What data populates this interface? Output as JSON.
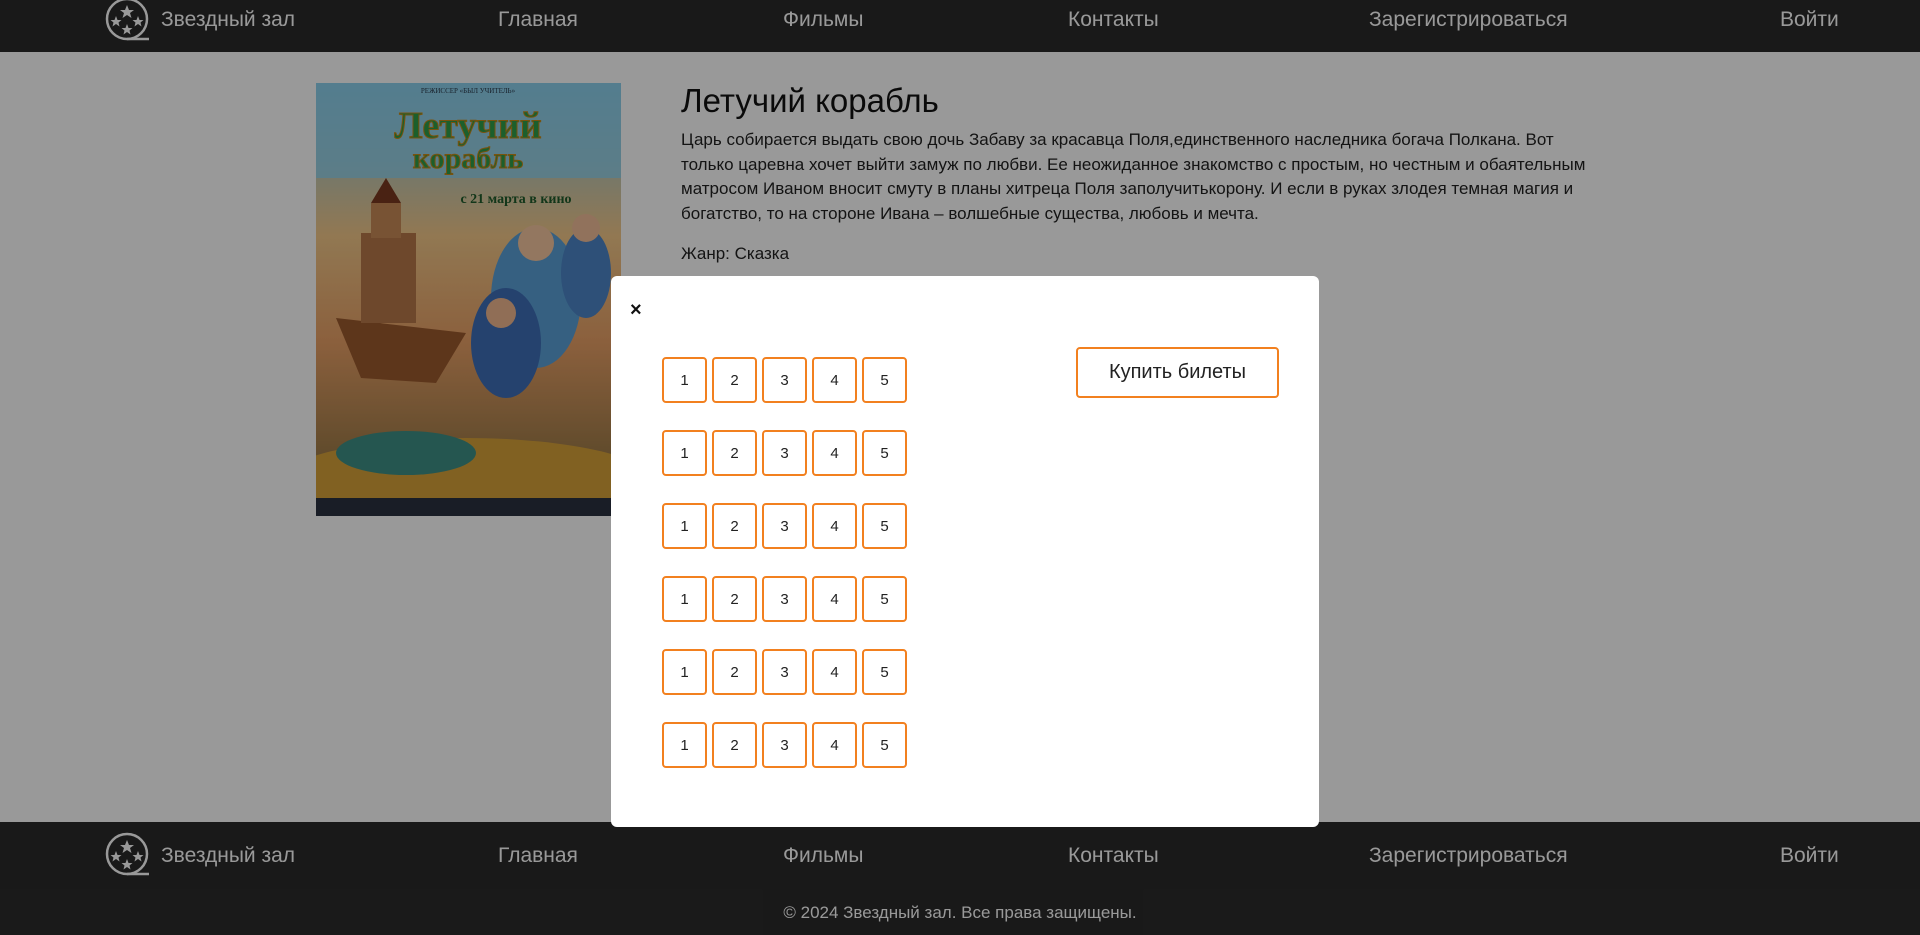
{
  "header": {
    "brand": "Звездный зал",
    "nav": [
      "Главная",
      "Фильмы",
      "Контакты",
      "Зарегистрироваться",
      "Войти"
    ]
  },
  "movie": {
    "title": "Летучий корабль",
    "description": "Царь собирается выдать свою дочь Забаву за красавца Поля,единственного наследника богача Полкана. Вот только царевна хочет выйти замуж по любви. Ее неожиданное знакомство с простым, но честным и обаятельным матросом Иваном вносит смуту в планы хитреца Поля заполучитькорону. И если в руках злодея темная магия и богатство, то на стороне Ивана – волшебные существа, любовь и мечта.",
    "genre": "Жанр: Сказка",
    "poster": {
      "top_text": "РЕЖИССЕР «БЫЛ УЧИТЕЛЬ»",
      "title_line1": "Летучий",
      "title_line2": "корабль",
      "release": "с 21 марта в кино"
    }
  },
  "modal": {
    "close_label": "×",
    "buy_label": "Купить билеты",
    "rows": [
      [
        "1",
        "2",
        "3",
        "4",
        "5"
      ],
      [
        "1",
        "2",
        "3",
        "4",
        "5"
      ],
      [
        "1",
        "2",
        "3",
        "4",
        "5"
      ],
      [
        "1",
        "2",
        "3",
        "4",
        "5"
      ],
      [
        "1",
        "2",
        "3",
        "4",
        "5"
      ],
      [
        "1",
        "2",
        "3",
        "4",
        "5"
      ]
    ]
  },
  "footer": {
    "brand": "Звездный зал",
    "nav": [
      "Главная",
      "Фильмы",
      "Контакты",
      "Зарегистрироваться",
      "Войти"
    ],
    "copyright": "© 2024 Звездный зал. Все права защищены."
  },
  "colors": {
    "nav_bg": "#2b2b2b",
    "accent": "#f2801f",
    "overlay": "rgba(0,0,0,0.40)"
  }
}
